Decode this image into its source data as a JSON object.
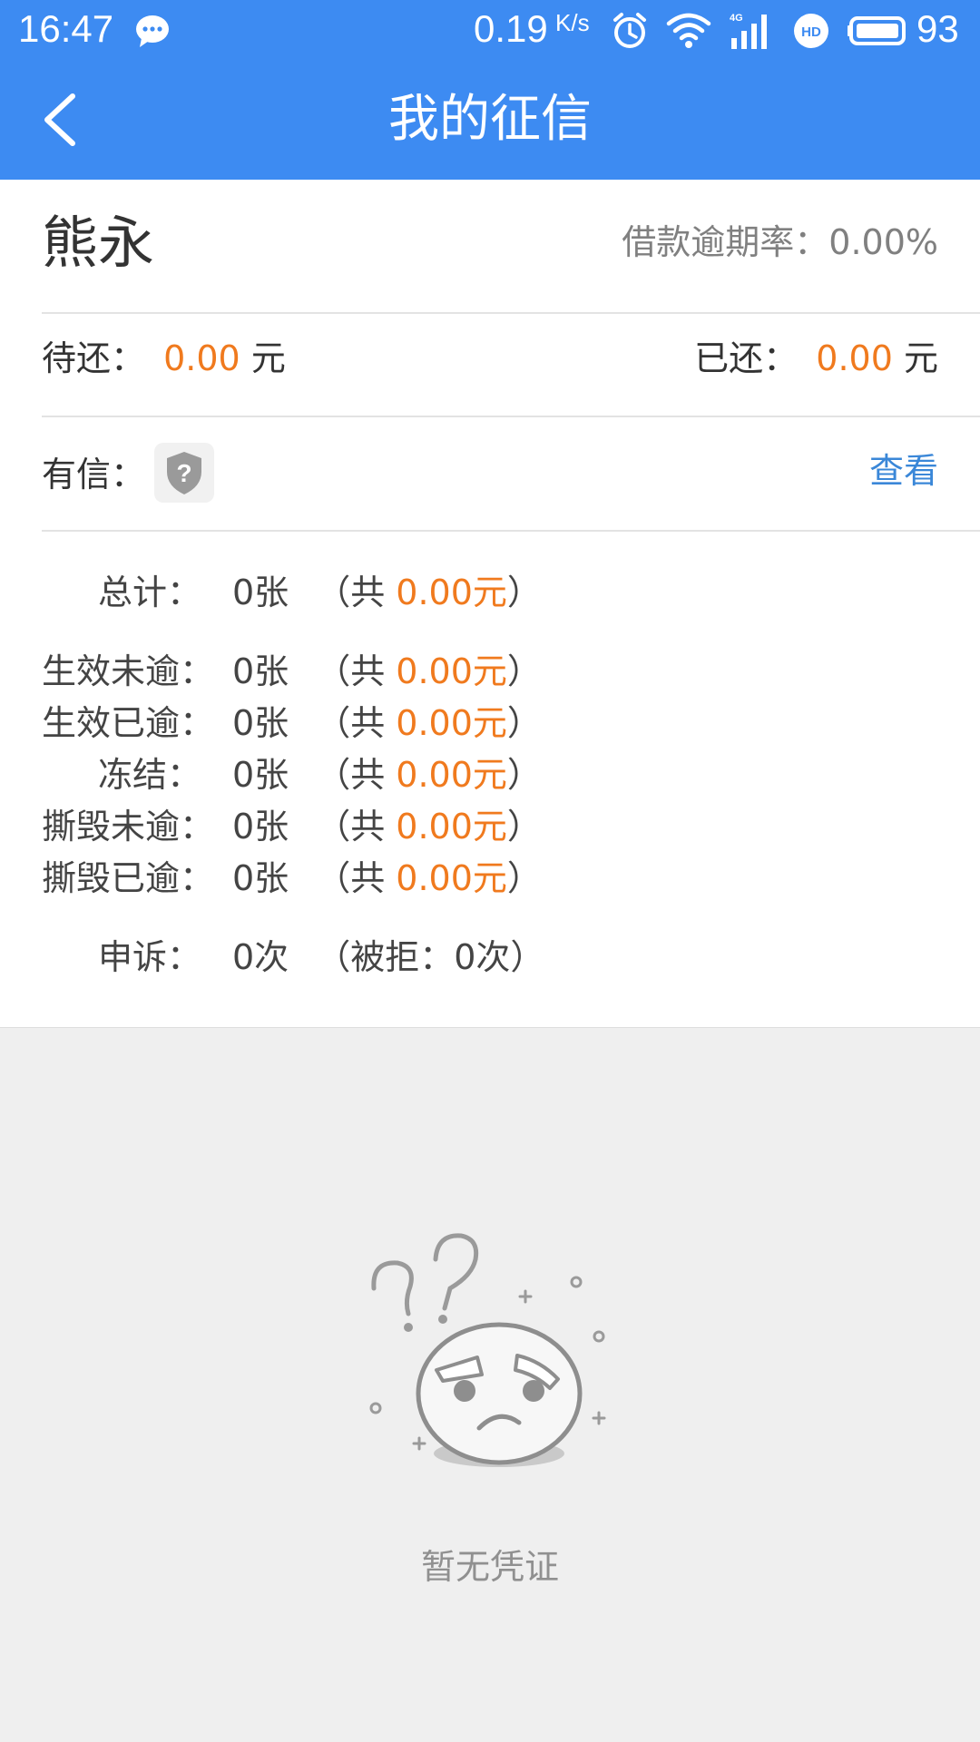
{
  "status_bar": {
    "time": "16:47",
    "speed_value": "0.19",
    "speed_unit": "K/s",
    "battery": "93",
    "icons": [
      "message-icon",
      "alarm-icon",
      "wifi-icon",
      "signal-4g-icon",
      "hd-icon",
      "battery-icon"
    ]
  },
  "nav": {
    "title": "我的征信",
    "back_icon": "back-arrow-icon"
  },
  "profile": {
    "name": "熊永",
    "overdue_rate_label": "借款逾期率：",
    "overdue_rate_value": "0.00%"
  },
  "balance": {
    "pending_label": "待还：",
    "pending_value": "0.00",
    "pending_unit": "元",
    "repaid_label": "已还：",
    "repaid_value": "0.00",
    "repaid_unit": "元"
  },
  "youxin": {
    "label": "有信：",
    "icon": "shield-question-icon",
    "view_link": "查看"
  },
  "stats": [
    {
      "label": "总计：",
      "count": "0张",
      "prefix": "（共 ",
      "amount": "0.00元",
      "suffix": "）"
    },
    {
      "label": "生效未逾：",
      "count": "0张",
      "prefix": "（共 ",
      "amount": "0.00元",
      "suffix": "）"
    },
    {
      "label": "生效已逾：",
      "count": "0张",
      "prefix": "（共 ",
      "amount": "0.00元",
      "suffix": "）"
    },
    {
      "label": "冻结：",
      "count": "0张",
      "prefix": "（共 ",
      "amount": "0.00元",
      "suffix": "）"
    },
    {
      "label": "撕毁未逾：",
      "count": "0张",
      "prefix": "（共 ",
      "amount": "0.00元",
      "suffix": "）"
    },
    {
      "label": "撕毁已逾：",
      "count": "0张",
      "prefix": "（共 ",
      "amount": "0.00元",
      "suffix": "）"
    }
  ],
  "appeal": {
    "label": "申诉：",
    "count": "0次",
    "detail": "（被拒：0次）"
  },
  "empty_state": {
    "icon": "confused-face-icon",
    "text": "暂无凭证"
  },
  "colors": {
    "primary": "#3d8bf2",
    "accent": "#f07a1e",
    "link": "#3a87d8",
    "background": "#efefef"
  }
}
